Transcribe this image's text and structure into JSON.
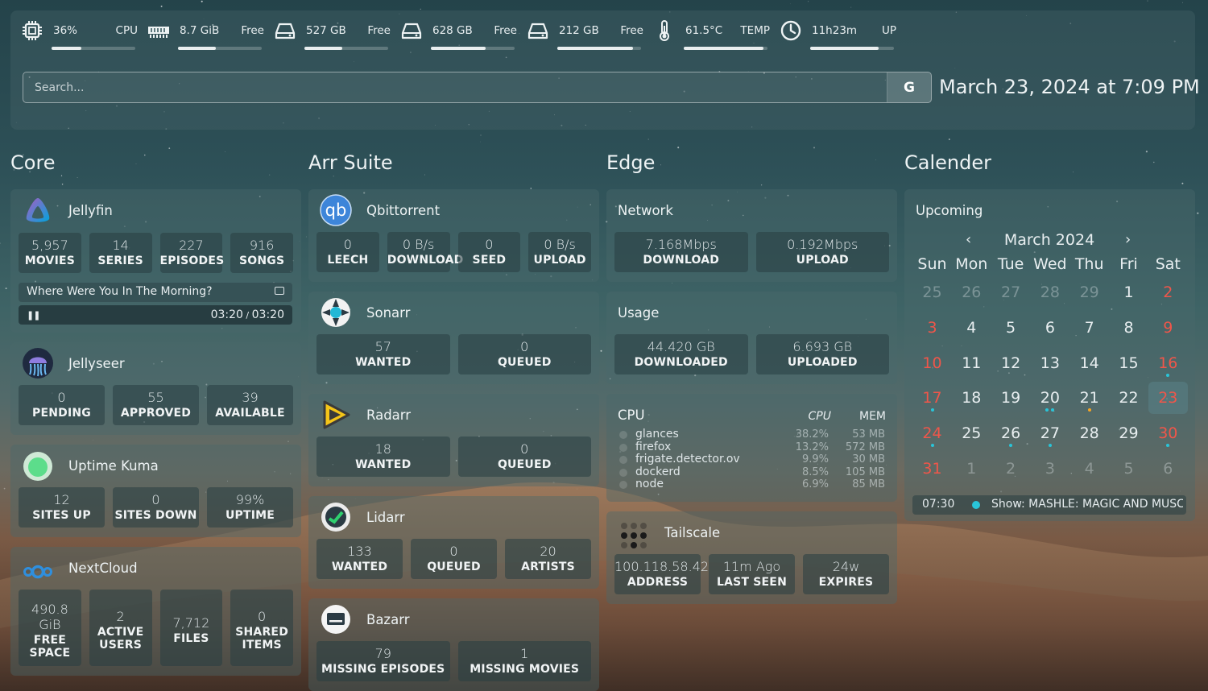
{
  "colors": {
    "weekend": "#f0564a",
    "other_month": "rgba(230,236,238,.35)",
    "event_dot": "#29c4d8",
    "accent_orange": "#f5a524"
  },
  "resources": [
    {
      "icon": "cpu-icon",
      "value": "36%",
      "label": "CPU",
      "fill": 0.36
    },
    {
      "icon": "memory-icon",
      "value": "8.7 GiB",
      "label": "Free",
      "fill": 0.45
    },
    {
      "icon": "disk-icon",
      "value": "527 GB",
      "label": "Free",
      "fill": 0.45
    },
    {
      "icon": "disk-icon",
      "value": "628 GB",
      "label": "Free",
      "fill": 0.65
    },
    {
      "icon": "disk-icon",
      "value": "212 GB",
      "label": "Free",
      "fill": 0.9
    },
    {
      "icon": "thermometer-icon",
      "value": "61.5°C",
      "label": "TEMP",
      "fill": 0.95
    },
    {
      "icon": "clock-icon",
      "value": "11h23m",
      "label": "UP",
      "fill": 0.82
    }
  ],
  "search": {
    "placeholder": "Search...",
    "button": "G"
  },
  "datetime": "March 23, 2024 at 7:09 PM",
  "columns": [
    "Core",
    "Arr Suite",
    "Edge",
    "Calender"
  ],
  "jellyfin": {
    "title": "Jellyfin",
    "stats": [
      [
        "5,957",
        "MOVIES"
      ],
      [
        "14",
        "SERIES"
      ],
      [
        "227",
        "EPISODES"
      ],
      [
        "916",
        "SONGS"
      ]
    ],
    "song": "Where Were You In The Morning?",
    "time": "03:20",
    "duration": "03:20"
  },
  "jellyseer": {
    "title": "Jellyseer",
    "stats": [
      [
        "0",
        "PENDING"
      ],
      [
        "55",
        "APPROVED"
      ],
      [
        "39",
        "AVAILABLE"
      ]
    ]
  },
  "uptime": {
    "title": "Uptime Kuma",
    "stats": [
      [
        "12",
        "SITES UP"
      ],
      [
        "0",
        "SITES DOWN"
      ],
      [
        "99%",
        "UPTIME"
      ]
    ]
  },
  "nextcloud": {
    "title": "NextCloud",
    "stats": [
      [
        "490.8 GiB",
        "FREE SPACE"
      ],
      [
        "2",
        "ACTIVE USERS"
      ],
      [
        "7,712",
        "FILES"
      ],
      [
        "0",
        "SHARED ITEMS"
      ]
    ]
  },
  "qbit": {
    "title": "Qbittorrent",
    "stats": [
      [
        "0",
        "LEECH"
      ],
      [
        "0 B/s",
        "DOWNLOAD"
      ],
      [
        "0",
        "SEED"
      ],
      [
        "0 B/s",
        "UPLOAD"
      ]
    ]
  },
  "sonarr": {
    "title": "Sonarr",
    "stats": [
      [
        "57",
        "WANTED"
      ],
      [
        "0",
        "QUEUED"
      ]
    ]
  },
  "radarr": {
    "title": "Radarr",
    "stats": [
      [
        "18",
        "WANTED"
      ],
      [
        "0",
        "QUEUED"
      ]
    ]
  },
  "lidarr": {
    "title": "Lidarr",
    "stats": [
      [
        "133",
        "WANTED"
      ],
      [
        "0",
        "QUEUED"
      ],
      [
        "20",
        "ARTISTS"
      ]
    ]
  },
  "bazarr": {
    "title": "Bazarr",
    "stats": [
      [
        "79",
        "MISSING EPISODES"
      ],
      [
        "1",
        "MISSING MOVIES"
      ]
    ]
  },
  "network": {
    "title": "Network",
    "stats": [
      [
        "7.168Mbps",
        "DOWNLOAD"
      ],
      [
        "0.192Mbps",
        "UPLOAD"
      ]
    ]
  },
  "usage": {
    "title": "Usage",
    "stats": [
      [
        "44.420 GB",
        "DOWNLOADED"
      ],
      [
        "6.693 GB",
        "UPLOADED"
      ]
    ]
  },
  "cpu": {
    "title": "CPU",
    "h_cpu": "CPU",
    "h_mem": "MEM",
    "rows": [
      [
        "glances",
        "38.2%",
        "53 MB"
      ],
      [
        "firefox",
        "13.2%",
        "572 MB"
      ],
      [
        "frigate.detector.ov",
        "9.9%",
        "30 MB"
      ],
      [
        "dockerd",
        "8.5%",
        "105 MB"
      ],
      [
        "node",
        "6.9%",
        "85 MB"
      ]
    ]
  },
  "tailscale": {
    "title": "Tailscale",
    "stats": [
      [
        "100.118.58.42",
        "ADDRESS"
      ],
      [
        "11m Ago",
        "LAST SEEN"
      ],
      [
        "24w",
        "EXPIRES"
      ]
    ]
  },
  "calendar": {
    "title": "Upcoming",
    "month": "March 2024",
    "prev": "‹",
    "next": "›",
    "dow": [
      "Sun",
      "Mon",
      "Tue",
      "Wed",
      "Thu",
      "Fri",
      "Sat"
    ],
    "weeks": [
      [
        [
          "25",
          0
        ],
        [
          "26",
          0
        ],
        [
          "27",
          0
        ],
        [
          "28",
          0
        ],
        [
          "29",
          0
        ],
        [
          "1",
          1
        ],
        [
          "2",
          1
        ]
      ],
      [
        [
          "3",
          1
        ],
        [
          "4",
          1
        ],
        [
          "5",
          1
        ],
        [
          "6",
          1
        ],
        [
          "7",
          1
        ],
        [
          "8",
          1
        ],
        [
          "9",
          1
        ]
      ],
      [
        [
          "10",
          1
        ],
        [
          "11",
          1
        ],
        [
          "12",
          1
        ],
        [
          "13",
          1
        ],
        [
          "14",
          1
        ],
        [
          "15",
          1
        ],
        [
          "16",
          1
        ]
      ],
      [
        [
          "17",
          1
        ],
        [
          "18",
          1
        ],
        [
          "19",
          1
        ],
        [
          "20",
          1
        ],
        [
          "21",
          1
        ],
        [
          "22",
          1
        ],
        [
          "23",
          1
        ]
      ],
      [
        [
          "24",
          1
        ],
        [
          "25",
          1
        ],
        [
          "26",
          1
        ],
        [
          "27",
          1
        ],
        [
          "28",
          1
        ],
        [
          "29",
          1
        ],
        [
          "30",
          1
        ]
      ],
      [
        [
          "31",
          1
        ],
        [
          "1",
          0
        ],
        [
          "2",
          0
        ],
        [
          "3",
          0
        ],
        [
          "4",
          0
        ],
        [
          "5",
          0
        ],
        [
          "6",
          0
        ]
      ]
    ],
    "today": "23",
    "markers": {
      "16": [
        "#29c4d8"
      ],
      "17": [
        "#29c4d8"
      ],
      "20": [
        "#29c4d8",
        "#29c4d8"
      ],
      "21": [
        "#f5a524"
      ],
      "24": [
        "#29c4d8"
      ],
      "26": [
        "#29c4d8"
      ],
      "27": [
        "#29c4d8"
      ],
      "30": [
        "#29c4d8"
      ]
    },
    "event": {
      "time": "07:30",
      "text": "Show: MASHLE: MAGIC AND MUSCL"
    }
  }
}
